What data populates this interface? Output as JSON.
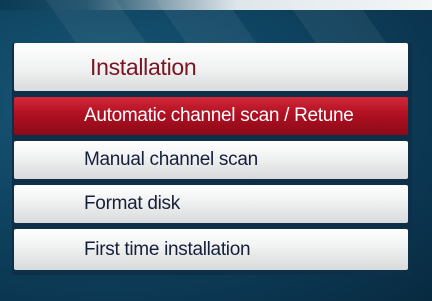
{
  "menu": {
    "title": "Installation",
    "items": [
      {
        "label": "Automatic channel scan / Retune",
        "selected": true
      },
      {
        "label": "Manual channel scan",
        "selected": false
      },
      {
        "label": "Format disk",
        "selected": false
      },
      {
        "label": "First time installation",
        "selected": false
      }
    ]
  },
  "colors": {
    "background": "#0f4663",
    "panel": "#0d3048",
    "title_text": "#7a1422",
    "item_text": "#17203a",
    "selected_bg": "#b01022",
    "selected_text": "#ffffff"
  }
}
